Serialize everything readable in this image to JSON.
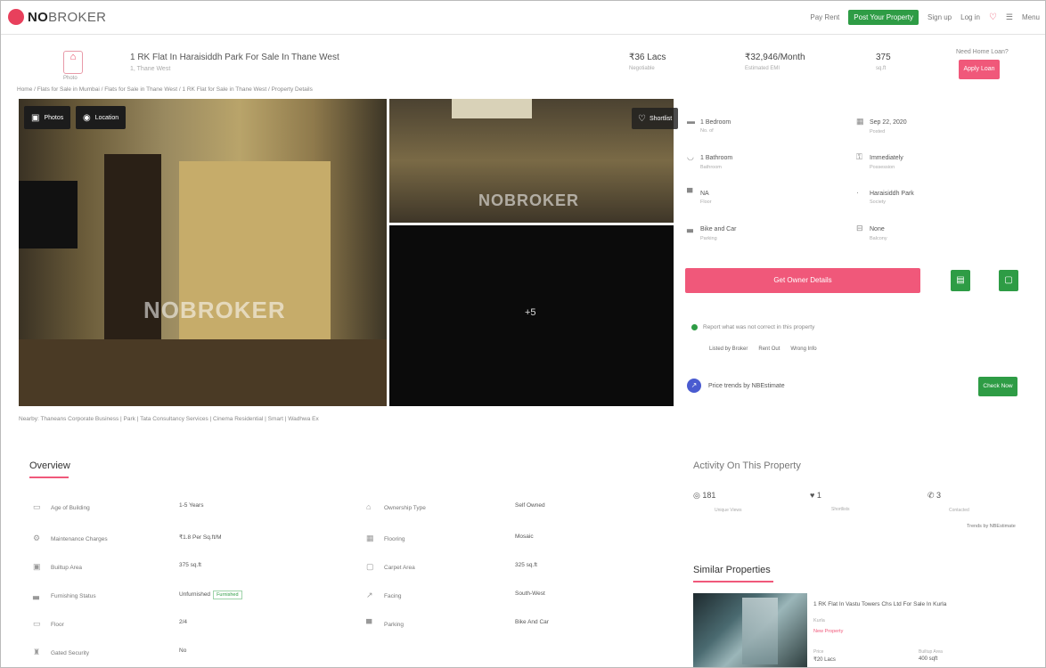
{
  "nav": {
    "logo_brand": "NO",
    "logo_rest": "BROKER",
    "links": [
      "Pay Rent",
      "Post Your Property",
      "Sign up",
      "Log in",
      "Menu"
    ]
  },
  "property": {
    "title": "1 RK Flat In Haraisiddh Park For Sale In Thane West",
    "subtitle": "1, Thane West",
    "icon_label": "Photo",
    "price": "₹36 Lacs",
    "price_sub": "Negotiable",
    "emi": "₹32,946/Month",
    "emi_sub": "Estimated EMI",
    "area": "375",
    "area_sub": "sq.ft",
    "loan_q": "Need Home Loan?",
    "loan_btn": "Apply Loan"
  },
  "breadcrumb": "Home / Flats for Sale in Mumbai / Flats for Sale in Thane West / 1 RK Flat for Sale in Thane West / Property Details",
  "gallery": {
    "photos_btn": "Photos",
    "location_btn": "Location",
    "shortlist_btn": "Shortlist",
    "more_count": "+5",
    "watermark": "NOBROKER"
  },
  "nearby": "Nearby: Thaneans Corporate Business | Park | Tata Consultancy Services | Cinema Residential | Smart | Wadhwa Ex",
  "details": [
    {
      "label": "1 Bedroom",
      "sub": "No. of",
      "icon": "bed-icon"
    },
    {
      "label": "Sep 22, 2020",
      "sub": "Posted",
      "icon": "calendar-icon"
    },
    {
      "label": "1 Bathroom",
      "sub": "Bathroom",
      "icon": "bath-icon"
    },
    {
      "label": "Immediately",
      "sub": "Possession",
      "icon": "key-icon"
    },
    {
      "label": "NA",
      "sub": "Floor",
      "icon": "building-icon"
    },
    {
      "label": "Haraisiddh Park",
      "sub": "Society",
      "icon": "location-icon"
    },
    {
      "label": "Bike and Car",
      "sub": "Parking",
      "icon": "car-icon"
    },
    {
      "label": "None",
      "sub": "Balcony",
      "icon": "balcony-icon"
    }
  ],
  "owner_btn": "Get Owner Details",
  "report": {
    "text": "Report what was not correct in this property",
    "opts": [
      "Listed by Broker",
      "Rent Out",
      "Wrong Info"
    ]
  },
  "price_trends": {
    "text": "Price trends by NBEstimate",
    "btn": "Check Now"
  },
  "overview": {
    "title": "Overview",
    "items": [
      {
        "label": "Age of Building",
        "value": "1-5 Years",
        "icon": "building-age-icon"
      },
      {
        "label": "Ownership Type",
        "value": "Self Owned",
        "icon": "ownership-icon"
      },
      {
        "label": "Maintenance Charges",
        "value": "₹1.8 Per Sq.ft/M",
        "icon": "maintenance-icon"
      },
      {
        "label": "Flooring",
        "value": "Mosaic",
        "icon": "flooring-icon"
      },
      {
        "label": "Builtup Area",
        "value": "375 sq.ft",
        "icon": "area-icon"
      },
      {
        "label": "Carpet Area",
        "value": "325 sq.ft",
        "icon": "carpet-icon"
      },
      {
        "label": "Furnishing Status",
        "value": "Unfurnished",
        "tag": "Furnished",
        "icon": "sofa-icon"
      },
      {
        "label": "Facing",
        "value": "South-West",
        "icon": "compass-icon"
      },
      {
        "label": "Floor",
        "value": "2/4",
        "icon": "floor-icon"
      },
      {
        "label": "Parking",
        "value": "Bike And Car",
        "icon": "parking-icon"
      },
      {
        "label": "Gated Security",
        "value": "No",
        "icon": "security-icon"
      }
    ]
  },
  "activity": {
    "title": "Activity On This Property",
    "views": "181",
    "views_sub": "Unique Views",
    "shortlists": "1",
    "shortlists_sub": "Shortlists",
    "contacted": "3",
    "contacted_sub": "Contacted",
    "footer": "Trends by NBEstimate"
  },
  "similar": {
    "title": "Similar Properties",
    "item_title": "1 RK Flat In Vastu Towers Chs Ltd For Sale In Kurla",
    "item_sub": "Kurla",
    "item_new": "New Property",
    "price": "₹20 Lacs",
    "area": "400 sqft",
    "price_label": "Price",
    "area_label": "Builtup Area"
  }
}
